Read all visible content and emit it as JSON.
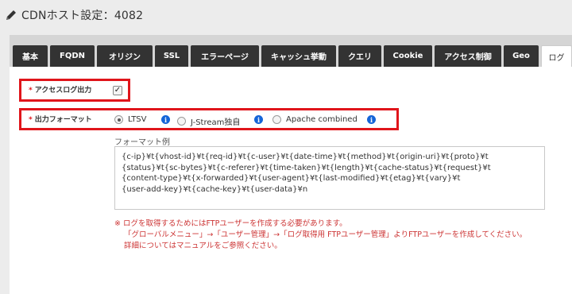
{
  "header": {
    "title": "CDNホスト設定：4082"
  },
  "tabs": [
    {
      "label": "基本"
    },
    {
      "label": "FQDN"
    },
    {
      "label": "オリジン"
    },
    {
      "label": "SSL"
    },
    {
      "label": "エラーページ"
    },
    {
      "label": "キャッシュ挙動"
    },
    {
      "label": "クエリ"
    },
    {
      "label": "Cookie"
    },
    {
      "label": "アクセス制御"
    },
    {
      "label": "Geo"
    },
    {
      "label": "ログ",
      "active": true
    }
  ],
  "form": {
    "access_log": {
      "required": "*",
      "label": "アクセスログ出力",
      "checked": true,
      "check_glyph": "✓"
    },
    "format": {
      "required": "*",
      "label": "出力フォーマット",
      "options": [
        {
          "label": "LTSV",
          "selected": true
        },
        {
          "label": "J-Stream独自",
          "selected": false
        },
        {
          "label": "Apache combined",
          "selected": false
        }
      ],
      "info_glyph": "i"
    },
    "example": {
      "label": "フォーマット例",
      "lines": [
        "{c-ip}¥t{vhost-id}¥t{req-id}¥t{c-user}¥t{date-time}¥t{method}¥t{origin-uri}¥t{proto}¥t",
        "{status}¥t{sc-bytes}¥t{c-referer}¥t{time-taken}¥t{length}¥t{cache-status}¥t{request}¥t",
        "{content-type}¥t{x-forwarded}¥t{user-agent}¥t{last-modified}¥t{etag}¥t{vary}¥t",
        "{user-add-key}¥t{cache-key}¥t{user-data}¥n"
      ]
    },
    "notes": [
      "※ ログを取得するためにはFTPユーザーを作成する必要があります。",
      "「グローバルメニュー」→「ユーザー管理」→「ログ取得用 FTPユーザー管理」よりFTPユーザーを作成してください。",
      "詳細についてはマニュアルをご参照ください。"
    ]
  },
  "colors": {
    "accent_red": "#e0151b",
    "tab_dark": "#333333",
    "info_blue": "#1565d8",
    "note_red": "#cc3333"
  }
}
